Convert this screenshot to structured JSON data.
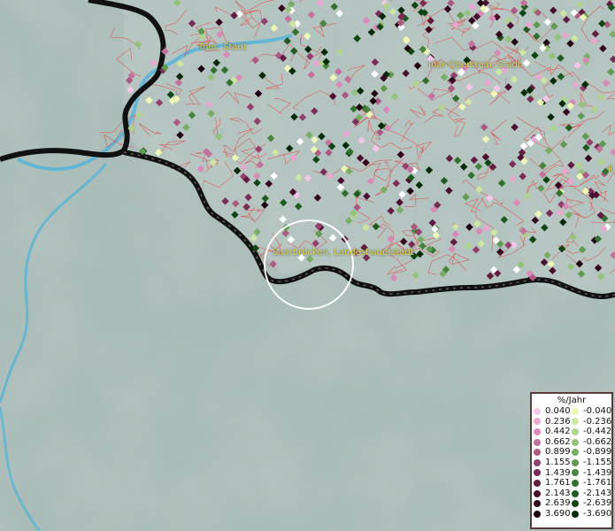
{
  "map": {
    "cities": [
      {
        "name": "Trier, Stadt"
      },
      {
        "name": "Idar-Oberstein, Stadt"
      },
      {
        "name": "Saarbrücken, Landeshauptstadt"
      },
      {
        "name": "K"
      }
    ]
  },
  "legend": {
    "title": "%/Jahr",
    "positive": [
      {
        "label": "0.040",
        "color": "#f4c6e8"
      },
      {
        "label": "0.236",
        "color": "#e8a6d0"
      },
      {
        "label": "0.442",
        "color": "#d889b6"
      },
      {
        "label": "0.662",
        "color": "#c4719c"
      },
      {
        "label": "0.899",
        "color": "#ad5a82"
      },
      {
        "label": "1.155",
        "color": "#93416a"
      },
      {
        "label": "1.439",
        "color": "#7a2c54"
      },
      {
        "label": "1.761",
        "color": "#621c40"
      },
      {
        "label": "2.143",
        "color": "#4a0f2e"
      },
      {
        "label": "2.639",
        "color": "#35061f"
      },
      {
        "label": "3.690",
        "color": "#1e0010"
      }
    ],
    "negative": [
      {
        "label": "-0.040",
        "color": "#eef7b4"
      },
      {
        "label": "-0.236",
        "color": "#cfe6a0"
      },
      {
        "label": "-0.442",
        "color": "#b0d38c"
      },
      {
        "label": "-0.662",
        "color": "#94c27a"
      },
      {
        "label": "-0.899",
        "color": "#78ad64"
      },
      {
        "label": "-1.155",
        "color": "#5e9a50"
      },
      {
        "label": "-1.439",
        "color": "#47853e"
      },
      {
        "label": "-1.761",
        "color": "#31702e"
      },
      {
        "label": "-2.143",
        "color": "#1f5a20"
      },
      {
        "label": "-2.639",
        "color": "#0f4414"
      },
      {
        "label": "-3.690",
        "color": "#042b08"
      }
    ]
  },
  "colors": {
    "terrain": "#a9bcb7",
    "river": "#4fb3d9",
    "border": "#111111",
    "districts": "#e04848",
    "label": "#d8d35a"
  }
}
